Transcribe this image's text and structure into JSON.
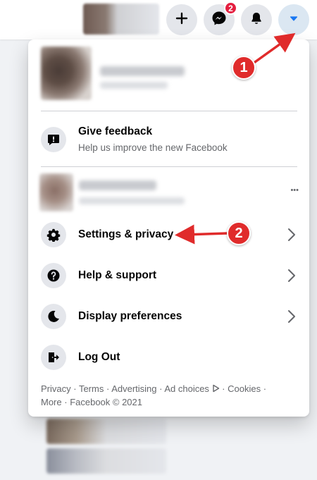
{
  "topbar": {
    "messenger_badge": "2",
    "buttons": [
      "create-button",
      "messenger-button",
      "notifications-button",
      "account-menu-button"
    ]
  },
  "menu": {
    "feedback": {
      "title": "Give feedback",
      "subtitle": "Help us improve the new Facebook"
    },
    "more_label": "•••",
    "items": [
      {
        "label": "Settings & privacy",
        "icon": "gear-icon",
        "has_chevron": true
      },
      {
        "label": "Help & support",
        "icon": "question-icon",
        "has_chevron": true
      },
      {
        "label": "Display preferences",
        "icon": "moon-icon",
        "has_chevron": true
      },
      {
        "label": "Log Out",
        "icon": "logout-icon",
        "has_chevron": false
      }
    ],
    "footer": {
      "privacy": "Privacy",
      "terms": "Terms",
      "advertising": "Advertising",
      "ad_choices": "Ad choices",
      "cookies": "Cookies",
      "more": "More",
      "copyright": "Facebook © 2021",
      "separator": " · "
    }
  },
  "annotations": {
    "step1": "1",
    "step2": "2"
  },
  "colors": {
    "accent_blue": "#1877f2",
    "annotation_red": "#e02b2b",
    "badge_red": "#e41e3f",
    "secondary_text": "#65676b"
  }
}
